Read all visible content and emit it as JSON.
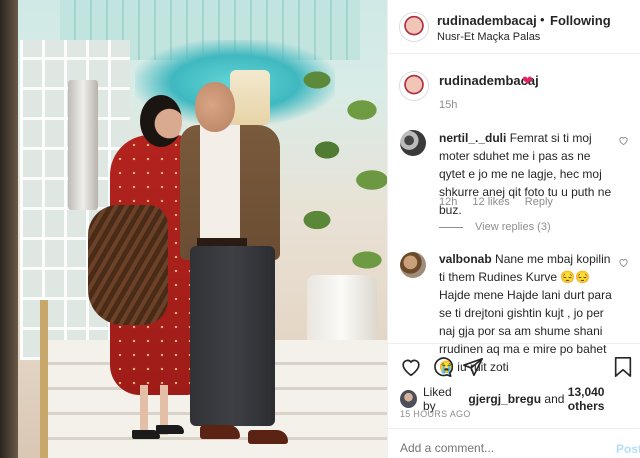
{
  "header": {
    "username": "rudinadembacaj",
    "separator": "•",
    "follow_state": "Following",
    "location": "Nusr-Et Maçka Palas"
  },
  "caption": {
    "username": "rudinadembacaj",
    "emoji": "❤",
    "time": "15h"
  },
  "comments": [
    {
      "username": "nertil_._duli",
      "text": "Femrat si ti moj moter sduhet me i pas as ne qytet e jo me ne lagje, hec moj shkurre anej qit foto tu u puth ne buz.",
      "time": "12h",
      "likes": "12 likes",
      "reply": "Reply",
      "view_replies": "View replies (3)"
    },
    {
      "username": "valbonab",
      "text": "Nane me mbaj kopilin ti them Rudines Kurve 😔😔 Hajde mene Hajde lani durt para se ti drejtoni gishtin kujt , jo per naj gja por sa am shume shani rrudinen aq ma e mire po bahet 😭 iu ruit zoti"
    }
  ],
  "likes": {
    "prefix": "Liked by",
    "user": "gjergj_bregu",
    "joiner": "and",
    "others": "13,040 others"
  },
  "posted_ago": "15 HOURS AGO",
  "add_comment": {
    "placeholder": "Add a comment...",
    "post_label": "Post"
  },
  "icons": {
    "like": "heart-outline-icon",
    "comment": "comment-bubble-icon",
    "share": "paper-plane-icon",
    "save": "bookmark-icon"
  },
  "colors": {
    "text": "#262626",
    "muted": "#8e8e8e",
    "heart_emoji": "#e0245e",
    "post_disabled": "#b2dffc"
  }
}
